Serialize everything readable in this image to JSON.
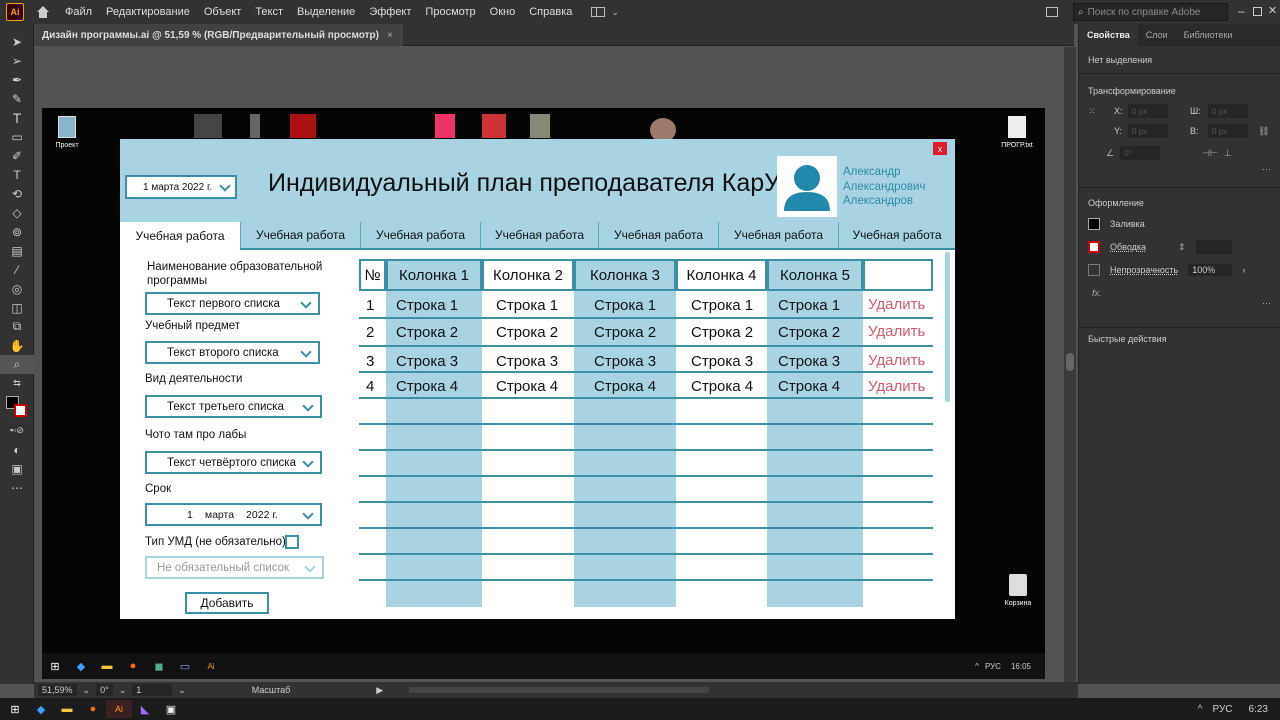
{
  "illustrator": {
    "logo": "Ai",
    "menu": [
      "Файл",
      "Редактирование",
      "Объект",
      "Текст",
      "Выделение",
      "Эффект",
      "Просмотр",
      "Окно",
      "Справка"
    ],
    "help_placeholder": "Поиск по справке Adobe",
    "doc_tab": "Дизайн программы.ai @ 51,59 % (RGB/Предварительный просмотр)",
    "panel_tabs": [
      "Свойства",
      "Слои",
      "Библиотеки"
    ],
    "no_selection": "Нет выделения",
    "transform_title": "Трансформирование",
    "field_placeholder": "0 px",
    "rotate_placeholder": "0°",
    "field_x": "X:",
    "field_y": "Y:",
    "field_w": "Ш:",
    "field_h": "В:",
    "appearance_title": "Оформление",
    "fill_label": "Заливка",
    "stroke_label": "Обводка",
    "opacity_label": "Непрозрачность",
    "opacity_value": "100%",
    "fx_label": "fx.",
    "quick_actions": "Быстрые действия",
    "zoom": "51,59%",
    "rotation_sb": "0°",
    "artboard_no": "1",
    "scale_label": "Масштаб",
    "lang": "РУС",
    "time": "6:23"
  },
  "desktop": {
    "project_label": "Проект",
    "file_label": "ПРОГР.txt",
    "trash_label": "Корзина",
    "lang": "РУС",
    "time": "16:05"
  },
  "app": {
    "close": "x",
    "date": "1 марта  2022 г.",
    "title": "Индивидуальный план преподавателя КарУК",
    "user": [
      "Александр",
      "Александрович",
      "Александров"
    ],
    "tabs": [
      "Учебная работа",
      "Учебная работа",
      "Учебная работа",
      "Учебная работа",
      "Учебная работа",
      "Учебная работа",
      "Учебная работа"
    ],
    "form": {
      "program_label": "Наименование образовательной программы",
      "program_value": "Текст первого списка",
      "subject_label": "Учебный предмет",
      "subject_value": "Текст второго списка",
      "activity_label": "Вид деятельности",
      "activity_value": "Текст третьего списка",
      "labs_label": "Чото там про лабы",
      "labs_value": "Текст четвёртого списка",
      "deadline_label": "Срок",
      "deadline_day": "1",
      "deadline_month": "марта",
      "deadline_year": "2022 г.",
      "umd_label": "Тип УМД  (не обязательно)",
      "umd_value": "Не обязательный список",
      "add_button": "Добавить"
    },
    "table": {
      "headers": [
        "№",
        "Колонка 1",
        "Колонка 2",
        "Колонка 3",
        "Колонка 4",
        "Колонка 5",
        ""
      ],
      "rows": [
        [
          "1",
          "Строка 1",
          "Строка 1",
          "Строка 1",
          "Строка 1",
          "Строка 1",
          "Удалить"
        ],
        [
          "2",
          "Строка 2",
          "Строка 2",
          "Строка 2",
          "Строка 2",
          "Строка 2",
          "Удалить"
        ],
        [
          "3",
          "Строка 3",
          "Строка 3",
          "Строка 3",
          "Строка 3",
          "Строка 3",
          "Удалить"
        ],
        [
          "4",
          "Строка 4",
          "Строка 4",
          "Строка 4",
          "Строка 4",
          "Строка 4",
          "Удалить"
        ]
      ]
    }
  },
  "colors": {
    "accent": "#3b8fa7",
    "light": "#a8d4e2",
    "delete": "#d9576b",
    "close": "#e01a2f",
    "user": "#2d8ba6"
  }
}
